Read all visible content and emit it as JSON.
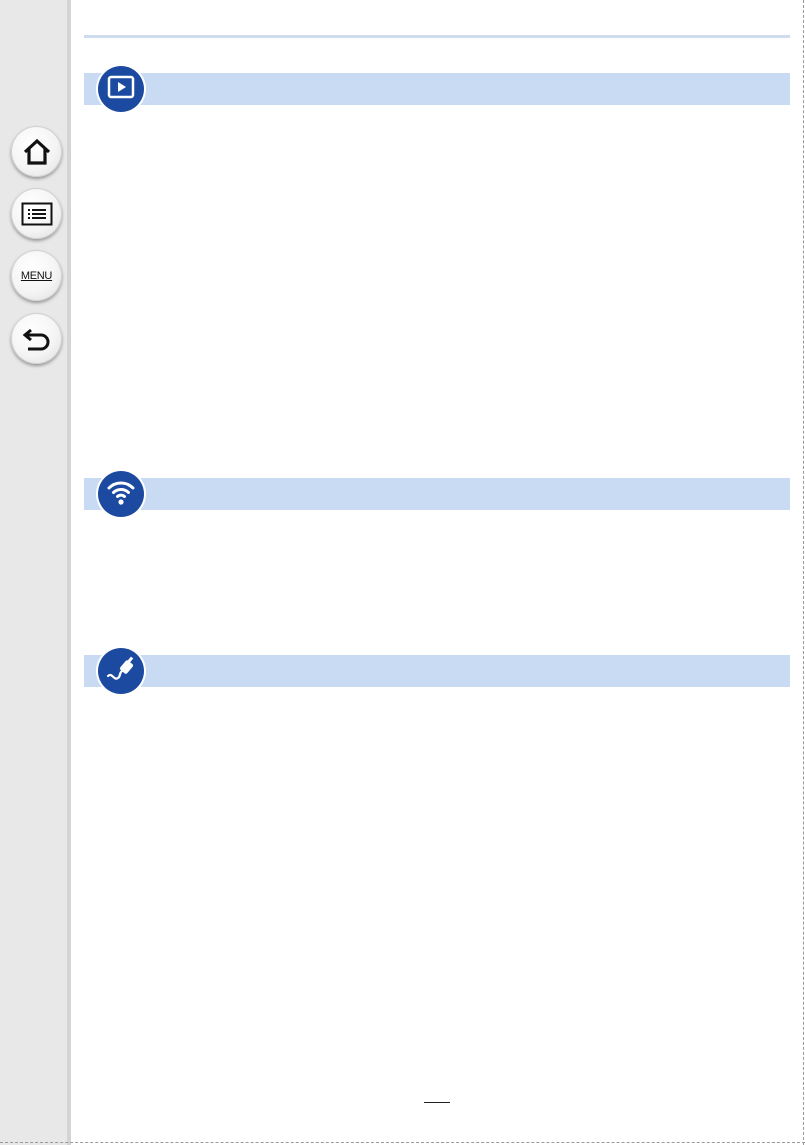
{
  "navigation": {
    "home_icon": "home-icon",
    "contents_icon": "list-icon",
    "menu_label": "MENU",
    "back_icon": "back-arrow-icon"
  },
  "sections": [
    {
      "icon": "playback-icon"
    },
    {
      "icon": "wifi-icon"
    },
    {
      "icon": "cable-connection-icon"
    }
  ],
  "colors": {
    "section_band": "#c9daf3",
    "section_icon": "#1c4aa0",
    "sidebar": "#e8e8e8"
  },
  "footer": {
    "page_number": ""
  }
}
